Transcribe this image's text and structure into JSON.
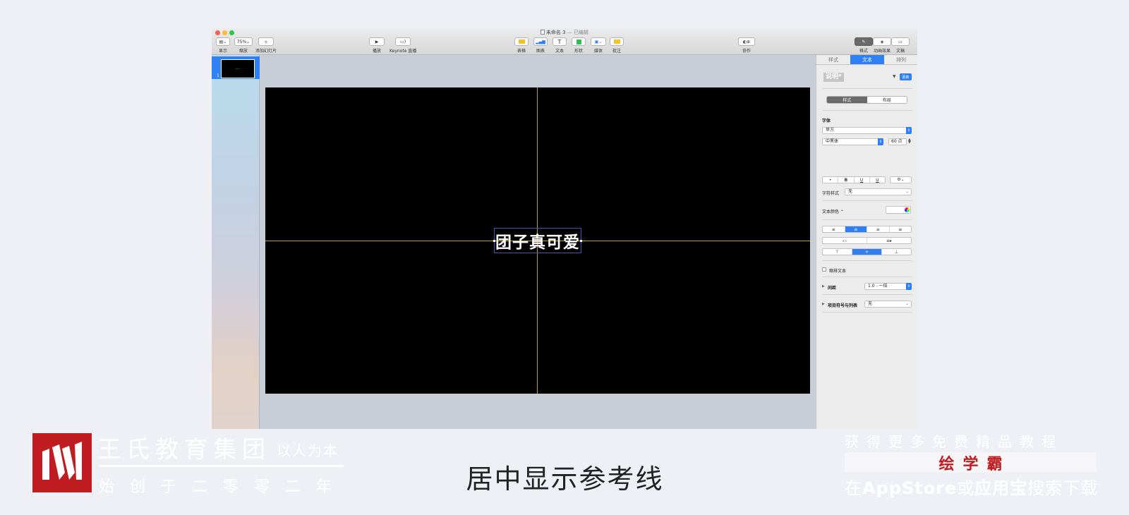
{
  "window": {
    "title": "未命名 3",
    "edited_suffix": " — 已编辑"
  },
  "toolbar": {
    "view_label": "显示",
    "zoom_value": "75%",
    "zoom_label": "缩放",
    "add_slide_label": "添加幻灯片",
    "play_label": "播放",
    "keynote_live_label": "Keynote 直播",
    "table_label": "表格",
    "chart_label": "图表",
    "text_label": "文本",
    "shape_label": "形状",
    "media_label": "媒体",
    "comment_label": "批注",
    "collaborate_label": "协作",
    "format_label": "格式",
    "animate_label": "动画效果",
    "document_label": "文稿"
  },
  "navigator": {
    "slide_number": "1",
    "thumb_text": "——"
  },
  "slide": {
    "text": "团子真可爱"
  },
  "inspector": {
    "tabs": [
      "样式",
      "文本",
      "排列"
    ],
    "paragraph_style": "说明*",
    "update_button": "更新",
    "segments": [
      "样式",
      "布局"
    ],
    "font_section": "字体",
    "font_family": "苹方",
    "font_weight": "中黑体",
    "font_size": "60 点",
    "style_buttons": [
      "•",
      "B",
      "U",
      "U"
    ],
    "gear_button": "⚙︎⌄",
    "char_style_label": "字符样式",
    "char_style_value": "无",
    "text_color_label": "文本颜色 ⌃",
    "align_buttons": [
      "≡",
      "≡",
      "≡",
      "≡"
    ],
    "indent_buttons": [
      "◂≡",
      "≡▸"
    ],
    "valign_buttons": [
      "⊤",
      "+",
      "⊥"
    ],
    "shrink_text_label": "缩排文本",
    "spacing_label": "间距",
    "spacing_value": "1.0 - 一倍",
    "bullets_label": "项目符号与列表",
    "bullets_value": "无"
  },
  "caption": {
    "text": "居中显示参考线"
  },
  "branding": {
    "name": "王氏教育集团",
    "slogan": "以人为本",
    "since": "始创于二零零二年",
    "promo_top": "获得更多免费精品教程",
    "promo_name": "绘学霸",
    "promo_bottom_1": "在",
    "promo_bottom_2": "AppStore",
    "promo_bottom_3": "或",
    "promo_bottom_4": "应用宝",
    "promo_bottom_5": "搜索下载"
  },
  "colors": {
    "accent_blue": "#2f80f5",
    "guide_yellow": "#c59a25",
    "brand_red": "#bf1d22"
  }
}
